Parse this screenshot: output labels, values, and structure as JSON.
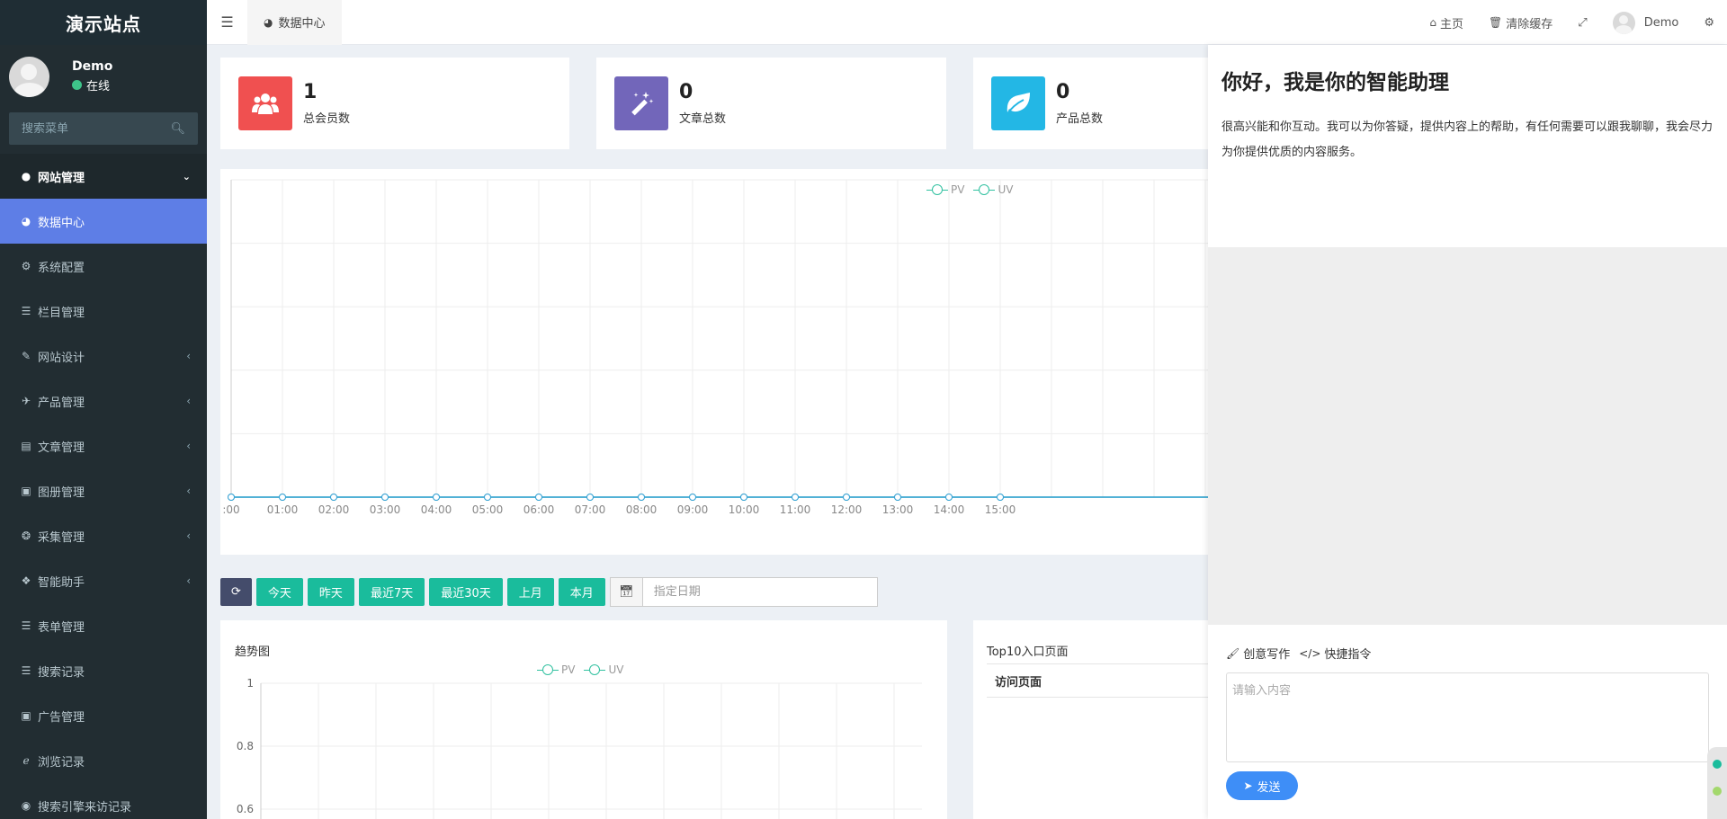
{
  "sidebar": {
    "logo": "演示站点",
    "user": {
      "name": "Demo",
      "status": "在线"
    },
    "search_placeholder": "搜索菜单",
    "items": [
      {
        "label": "网站管理",
        "icon": "globe-icon",
        "type": "header",
        "arrow": "⌄"
      },
      {
        "label": "数据中心",
        "icon": "dashboard-icon",
        "type": "active"
      },
      {
        "label": "系统配置",
        "icon": "cogs-icon"
      },
      {
        "label": "栏目管理",
        "icon": "list-icon"
      },
      {
        "label": "网站设计",
        "icon": "paint-brush-icon",
        "arrow": "‹"
      },
      {
        "label": "产品管理",
        "icon": "plane-icon",
        "arrow": "‹"
      },
      {
        "label": "文章管理",
        "icon": "newspaper-icon",
        "arrow": "‹"
      },
      {
        "label": "图册管理",
        "icon": "image-icon",
        "arrow": "‹"
      },
      {
        "label": "采集管理",
        "icon": "bug-icon",
        "arrow": "‹"
      },
      {
        "label": "智能助手",
        "icon": "comments-icon",
        "arrow": "‹"
      },
      {
        "label": "表单管理",
        "icon": "list-icon"
      },
      {
        "label": "搜索记录",
        "icon": "list-icon"
      },
      {
        "label": "广告管理",
        "icon": "image-icon"
      },
      {
        "label": "浏览记录",
        "icon": "ie-icon"
      },
      {
        "label": "搜索引擎来访记录",
        "icon": "chrome-icon"
      }
    ]
  },
  "topbar": {
    "tab_label": "数据中心",
    "home": "主页",
    "clear_cache": "清除缓存",
    "user_name": "Demo"
  },
  "stats": [
    {
      "value": "1",
      "label": "总会员数",
      "color": "#f05050",
      "icon": "users-icon"
    },
    {
      "value": "0",
      "label": "文章总数",
      "color": "#7266ba",
      "icon": "magic-icon"
    },
    {
      "value": "0",
      "label": "产品总数",
      "color": "#23b7e5",
      "icon": "leaf-icon"
    }
  ],
  "chart_data": [
    {
      "type": "line",
      "title": "",
      "legend": [
        "PV",
        "UV"
      ],
      "legend_position": "top-center",
      "x_ticks_visible": [
        ":00",
        "01:00",
        "02:00",
        "03:00",
        "04:00",
        "05:00",
        "06:00",
        "07:00",
        "08:00",
        "09:00",
        "10:00",
        "11:00",
        "12:00",
        "13:00",
        "14:00",
        "15:00"
      ],
      "series": [
        {
          "name": "PV",
          "values": [
            0,
            0,
            0,
            0,
            0,
            0,
            0,
            0,
            0,
            0,
            0,
            0,
            0,
            0,
            0,
            0
          ]
        },
        {
          "name": "UV",
          "values": [
            0,
            0,
            0,
            0,
            0,
            0,
            0,
            0,
            0,
            0,
            0,
            0,
            0,
            0,
            0,
            0
          ]
        }
      ],
      "grid": true
    },
    {
      "type": "line",
      "title": "趋势图",
      "legend": [
        "PV",
        "UV"
      ],
      "legend_position": "top-center",
      "y_ticks_visible": [
        "1",
        "0.8",
        "0.6"
      ],
      "ylim": [
        0,
        1
      ],
      "grid": true
    }
  ],
  "filters": {
    "buttons": [
      "今天",
      "昨天",
      "最近7天",
      "最近30天",
      "上月",
      "本月"
    ],
    "date_placeholder": "指定日期"
  },
  "top10": {
    "title": "Top10入口页面",
    "column": "访问页面"
  },
  "assistant": {
    "title": "你好，我是你的智能助理",
    "intro": "很高兴能和你互动。我可以为你答疑，提供内容上的帮助，有任何需要可以跟我聊聊，我会尽力为你提供优质的内容服务。",
    "tool_write": "创意写作",
    "tool_commands": "快捷指令",
    "input_placeholder": "请输入内容",
    "send_label": "发送"
  }
}
